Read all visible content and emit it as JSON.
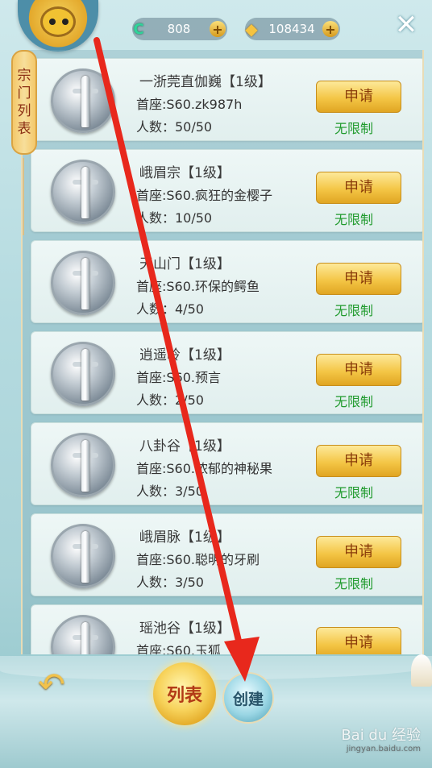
{
  "currency": {
    "jade_value": "808",
    "gold_value": "108434",
    "plus_label": "+"
  },
  "close_label": "✕",
  "side_tab": [
    "宗",
    "门",
    "列",
    "表"
  ],
  "sects": [
    {
      "name": "一浙莞直伽巍【1级】",
      "leader": "首座:S60.zk987h",
      "members": "人数：50/50",
      "apply_label": "申请",
      "limit": "无限制"
    },
    {
      "name": "峨眉宗【1级】",
      "leader": "首座:S60.疯狂的金樱子",
      "members": "人数：10/50",
      "apply_label": "申请",
      "limit": "无限制"
    },
    {
      "name": "天山门【1级】",
      "leader": "首座:S60.环保的鳄鱼",
      "members": "人数：4/50",
      "apply_label": "申请",
      "limit": "无限制"
    },
    {
      "name": "逍遥岭【1级】",
      "leader": "首座:S60.预言",
      "members": "人数：2/50",
      "apply_label": "申请",
      "limit": "无限制"
    },
    {
      "name": "八卦谷【1级】",
      "leader": "首座:S60.浓郁的神秘果",
      "members": "人数：3/50",
      "apply_label": "申请",
      "limit": "无限制"
    },
    {
      "name": "峨眉脉【1级】",
      "leader": "首座:S60.聪明的牙刷",
      "members": "人数：3/50",
      "apply_label": "申请",
      "limit": "无限制"
    },
    {
      "name": "瑶池谷【1级】",
      "leader": "首座:S60.玉狐",
      "members": "",
      "apply_label": "申请",
      "limit": ""
    }
  ],
  "tabs": {
    "list_label": "列表",
    "create_label": "创建"
  },
  "back_icon": "↶",
  "watermark": {
    "brand": "Bai du 经验",
    "url": "jingyan.baidu.com"
  },
  "colors": {
    "accent_gold": "#f4c646",
    "limit_green": "#1f9a2c",
    "arrow_red": "#e8281c"
  }
}
